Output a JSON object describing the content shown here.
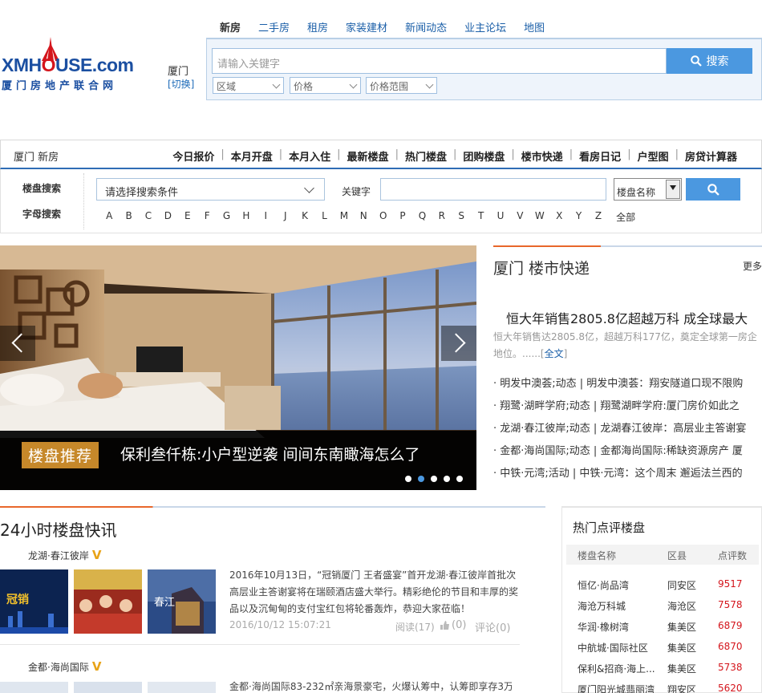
{
  "header": {
    "logo_main_a": "XMH",
    "logo_main_o": "O",
    "logo_main_b": "USE.com",
    "logo_sub": "厦门房地产联合网",
    "city": "厦门",
    "switch": "[切换]",
    "tabs": [
      "新房",
      "二手房",
      "租房",
      "家装建材",
      "新闻动态",
      "业主论坛",
      "地图"
    ],
    "active_tab": 0,
    "search_placeholder": "请输入关键字",
    "search_button": "搜索",
    "selects": [
      "区域",
      "价格",
      "价格范围"
    ]
  },
  "nav": {
    "title": "厦门 新房",
    "links": [
      "今日报价",
      "本月开盘",
      "本月入住",
      "最新楼盘",
      "热门楼盘",
      "团购楼盘",
      "楼市快递",
      "看房日记",
      "户型图",
      "房贷计算器"
    ]
  },
  "filter": {
    "search_label": "楼盘搜索",
    "condition_select": "请选择搜索条件",
    "keyword_label": "关键字",
    "keyword_type": "楼盘名称",
    "letter_label": "字母搜索",
    "letters": [
      "A",
      "B",
      "C",
      "D",
      "E",
      "F",
      "G",
      "H",
      "I",
      "J",
      "K",
      "L",
      "M",
      "N",
      "O",
      "P",
      "Q",
      "R",
      "S",
      "T",
      "U",
      "V",
      "W",
      "X",
      "Y",
      "Z"
    ],
    "all": "全部"
  },
  "slider": {
    "tag": "楼盘推荐",
    "caption": "保利叁仟栋:小户型逆袭 间间东南瞰海怎么了",
    "dots": 5,
    "active_dot": 1
  },
  "news": {
    "title": "厦门 楼市快递",
    "more": "更多",
    "headline": "恒大年销售2805.8亿超越万科 成全球最大",
    "summary": "恒大年销售达2805.8亿，超越万科177亿，奠定全球第一房企地位。......",
    "summary_link": "全文",
    "items": [
      "· 明发中澳荟;动态 | 明发中澳荟：翔安隧道口现不限购",
      "· 翔鹭·湖畔学府;动态 | 翔鹭湖畔学府:厦门房价如此之",
      "· 龙湖·春江彼岸;动态 | 龙湖春江彼岸：高层业主答谢宴",
      "· 金都·海尚国际;动态 | 金都海尚国际:稀缺资源房产 厦",
      "· 中铁·元湾;活动 | 中铁·元湾：这个周末 邂逅法兰西的"
    ]
  },
  "h24": {
    "title": "24小时楼盘快讯",
    "items": [
      {
        "project": "龙湖·春江彼岸",
        "badge": "V",
        "text": "2016年10月13日，“冠销厦门 王者盛宴”首开龙湖·春江彼岸首批次高层业主答谢宴将在瑞颐酒店盛大举行。精彩绝伦的节目和丰厚的奖品以及沉甸甸的支付宝红包将轮番轰炸，恭迎大家莅临！",
        "time": "2016/10/12 15:07:21",
        "reads": "阅读(17)",
        "likes": "(0)",
        "comments": "评论(0)"
      },
      {
        "project": "金都·海尚国际",
        "badge": "V",
        "text": "金都·海尚国际83-232㎡亲海景豪宅，火爆认筹中，认筹即享存3万"
      }
    ]
  },
  "hot": {
    "title": "热门点评楼盘",
    "headers": [
      "楼盘名称",
      "区县",
      "点评数"
    ],
    "rows": [
      [
        "恒亿·尚品湾",
        "同安区",
        "9517"
      ],
      [
        "海沧万科城",
        "海沧区",
        "7578"
      ],
      [
        "华润·橡树湾",
        "集美区",
        "6879"
      ],
      [
        "中航城·国际社区",
        "集美区",
        "6870"
      ],
      [
        "保利&招商·海上...",
        "集美区",
        "5738"
      ],
      [
        "厦门阳光城翡丽湾",
        "翔安区",
        "5620"
      ]
    ]
  },
  "colors": {
    "brand_blue": "#1b4fa1",
    "accent_blue": "#4b98e0",
    "accent_orange": "#e8672b",
    "tag_gold": "#c6882a"
  }
}
